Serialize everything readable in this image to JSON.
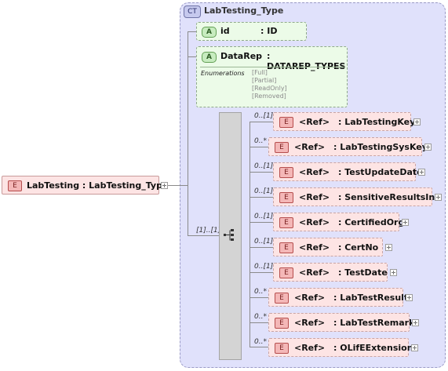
{
  "complex_type": {
    "badge": "CT",
    "name": "LabTesting_Type"
  },
  "root_element": {
    "badge": "E",
    "label": "LabTesting : LabTesting_Type"
  },
  "attributes": [
    {
      "badge": "A",
      "name": "id",
      "type": ": ID"
    },
    {
      "badge": "A",
      "name": "DataRep",
      "type": ": DATAREP_TYPES",
      "enumerations_label": "Enumerations",
      "enumerations": [
        "[Full]",
        "[Partial]",
        "[ReadOnly]",
        "[Removed]"
      ]
    }
  ],
  "sequence": {
    "cardinality": "[1]..[1]"
  },
  "elements": [
    {
      "badge": "E",
      "cardinality": "0..[1]",
      "ref": "<Ref>",
      "name": ": LabTestingKey"
    },
    {
      "badge": "E",
      "cardinality": "0..*",
      "ref": "<Ref>",
      "name": ": LabTestingSysKey"
    },
    {
      "badge": "E",
      "cardinality": "0..[1]",
      "ref": "<Ref>",
      "name": ": TestUpdateDate"
    },
    {
      "badge": "E",
      "cardinality": "0..[1]",
      "ref": "<Ref>",
      "name": ": SensitiveResultsInd"
    },
    {
      "badge": "E",
      "cardinality": "0..[1]",
      "ref": "<Ref>",
      "name": ": CertifiedOrg"
    },
    {
      "badge": "E",
      "cardinality": "0..[1]",
      "ref": "<Ref>",
      "name": ": CertNo"
    },
    {
      "badge": "E",
      "cardinality": "0..[1]",
      "ref": "<Ref>",
      "name": ": TestDate"
    },
    {
      "badge": "E",
      "cardinality": "0..*",
      "ref": "<Ref>",
      "name": ": LabTestResult"
    },
    {
      "badge": "E",
      "cardinality": "0..*",
      "ref": "<Ref>",
      "name": ": LabTestRemark"
    },
    {
      "badge": "E",
      "cardinality": "0..*",
      "ref": "<Ref>",
      "name": ": OLifEExtension"
    }
  ]
}
